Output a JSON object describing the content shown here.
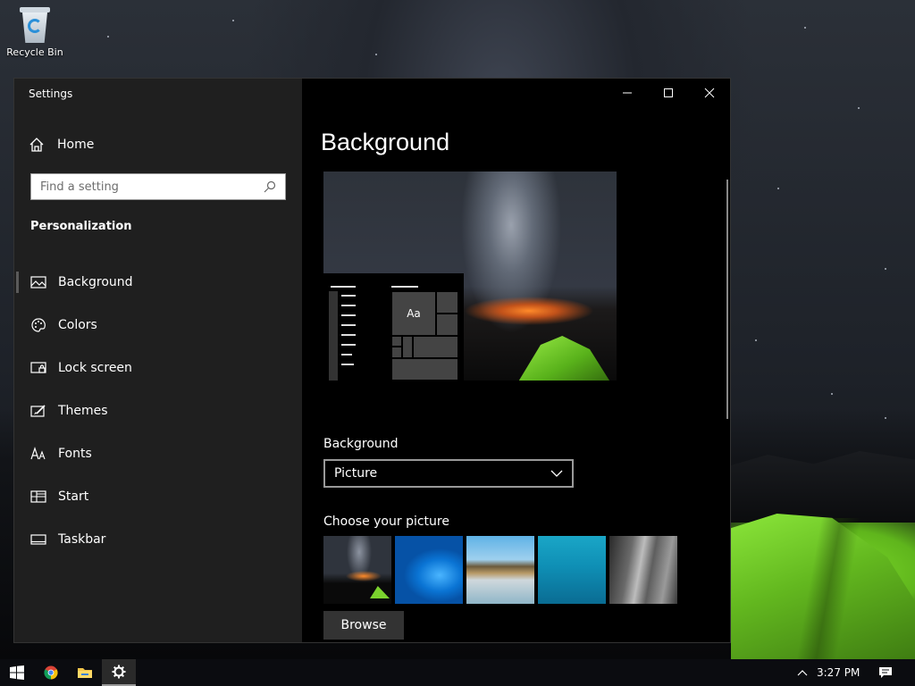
{
  "desktop": {
    "recycle_bin_label": "Recycle Bin"
  },
  "window": {
    "title": "Settings",
    "controls": [
      "minimize",
      "maximize",
      "close"
    ]
  },
  "sidebar": {
    "home_label": "Home",
    "search_placeholder": "Find a setting",
    "section_title": "Personalization",
    "items": [
      {
        "label": "Background",
        "icon": "picture-icon",
        "active": true
      },
      {
        "label": "Colors",
        "icon": "palette-icon"
      },
      {
        "label": "Lock screen",
        "icon": "lock-screen-icon"
      },
      {
        "label": "Themes",
        "icon": "themes-brush-icon"
      },
      {
        "label": "Fonts",
        "icon": "fonts-icon"
      },
      {
        "label": "Start",
        "icon": "start-icon"
      },
      {
        "label": "Taskbar",
        "icon": "taskbar-icon"
      }
    ]
  },
  "main": {
    "page_title": "Background",
    "preview_sample_text": "Aa",
    "background_label": "Background",
    "background_value": "Picture",
    "choose_picture_label": "Choose your picture",
    "thumbnails": [
      "milky-way-tent",
      "windows-blue",
      "beach-rocks",
      "underwater-swimmer",
      "rock-cliff"
    ],
    "browse_label": "Browse"
  },
  "taskbar": {
    "items": [
      "start-icon",
      "chrome-icon",
      "file-explorer-icon",
      "settings-icon"
    ],
    "time": "3:27 PM"
  }
}
